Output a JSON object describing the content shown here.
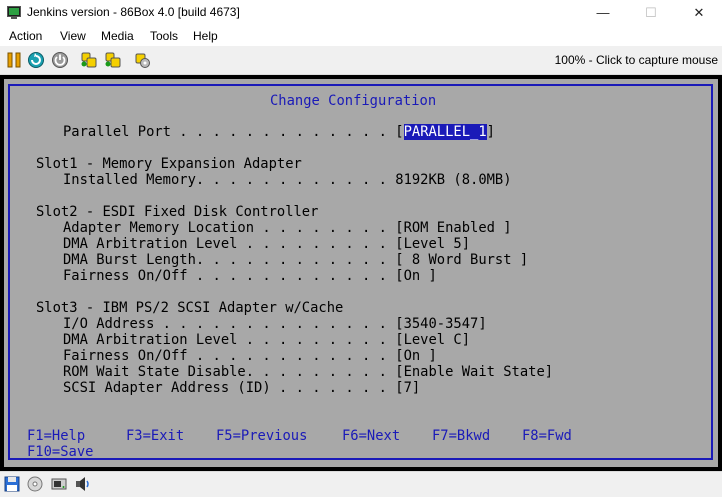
{
  "window": {
    "title": "Jenkins version - 86Box 4.0 [build 4673]",
    "minimize_glyph": "—",
    "maximize_glyph": "☐",
    "close_glyph": "✕"
  },
  "menu": {
    "items": [
      "Action",
      "View",
      "Media",
      "Tools",
      "Help"
    ]
  },
  "toolbar": {
    "icons": [
      "pause-icon",
      "reset-icon",
      "power-icon",
      "ctrl-alt-del-icon",
      "ctrl-alt-esc-icon",
      "settings-icon"
    ],
    "status": "100% - Click to capture mouse"
  },
  "screen": {
    "heading": "Change Configuration",
    "parallel_label": "Parallel Port . . . . . . . . . . . . . [",
    "parallel_value": "PARALLEL_1",
    "parallel_close": "]",
    "slot1": {
      "title": "Slot1 - Memory Expansion Adapter",
      "lines": [
        "Installed Memory. . . . . . . . . . . . 8192KB (8.0MB)"
      ]
    },
    "slot2": {
      "title": "Slot2 - ESDI Fixed Disk Controller",
      "lines": [
        "Adapter Memory Location . . . . . . . . [ROM Enabled ]",
        "DMA Arbitration Level . . . . . . . . . [Level 5]",
        "DMA Burst Length. . . . . . . . . . . . [ 8 Word Burst ]",
        "Fairness On/Off . . . . . . . . . . . . [On ]"
      ]
    },
    "slot3": {
      "title": "Slot3 - IBM PS/2 SCSI Adapter w/Cache",
      "lines": [
        "I/O Address . . . . . . . . . . . . . . [3540-3547]",
        "DMA Arbitration Level . . . . . . . . . [Level C]",
        "Fairness On/Off . . . . . . . . . . . . [On ]",
        "ROM Wait State Disable. . . . . . . . . [Enable Wait State]",
        "SCSI Adapter Address (ID) . . . . . . . [7]"
      ]
    },
    "function_keys": [
      "F1=Help",
      "F3=Exit",
      "F5=Previous",
      "F6=Next",
      "F7=Bkwd",
      "F8=Fwd"
    ],
    "save_key": "F10=Save"
  },
  "statusbar": {
    "icons": [
      "floppy-icon",
      "cdrom-icon",
      "hard-disk-icon",
      "sound-icon"
    ]
  }
}
